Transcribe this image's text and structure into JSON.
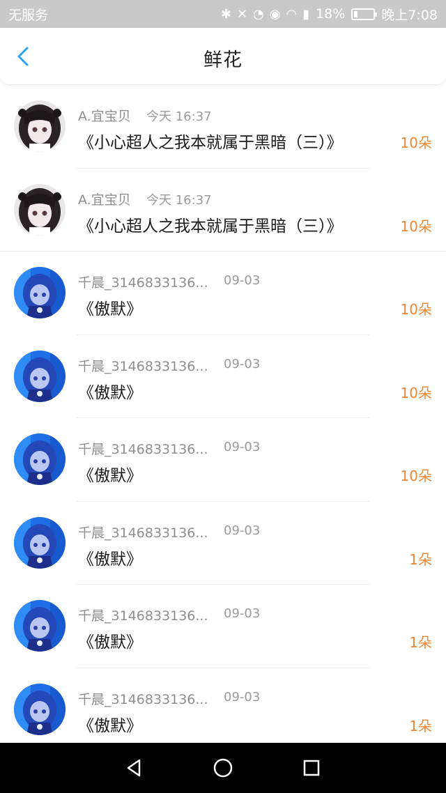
{
  "status_bar": {
    "carrier": "无服务",
    "battery": "18%",
    "time": "晚上7:08",
    "battery_level": 0.18,
    "icons": [
      "bluetooth-icon",
      "mute-icon",
      "alarm-icon",
      "eye-icon",
      "wifi-icon",
      "signal-icon"
    ]
  },
  "header": {
    "title": "鲜花"
  },
  "colors": {
    "accent": "#2ba3f0",
    "count": "#ee8530",
    "name": "#8e8e8e"
  },
  "items": [
    {
      "name": "A.宜宝贝",
      "time": "今天 16:37",
      "work": "《小心超人之我本就属于黑暗（三）》",
      "count": "10朵",
      "avatar": "dark"
    },
    {
      "name": "A.宜宝贝",
      "time": "今天 16:37",
      "work": "《小心超人之我本就属于黑暗（三）》",
      "count": "10朵",
      "avatar": "dark"
    },
    {
      "name": "千晨_3146833136...",
      "time": "09-03",
      "work": "《傲默》",
      "count": "10朵",
      "avatar": "blue"
    },
    {
      "name": "千晨_3146833136...",
      "time": "09-03",
      "work": "《傲默》",
      "count": "10朵",
      "avatar": "blue"
    },
    {
      "name": "千晨_3146833136...",
      "time": "09-03",
      "work": "《傲默》",
      "count": "10朵",
      "avatar": "blue"
    },
    {
      "name": "千晨_3146833136...",
      "time": "09-03",
      "work": "《傲默》",
      "count": "1朵",
      "avatar": "blue"
    },
    {
      "name": "千晨_3146833136...",
      "time": "09-03",
      "work": "《傲默》",
      "count": "1朵",
      "avatar": "blue"
    },
    {
      "name": "千晨_3146833136...",
      "time": "09-03",
      "work": "《傲默》",
      "count": "1朵",
      "avatar": "blue"
    }
  ]
}
